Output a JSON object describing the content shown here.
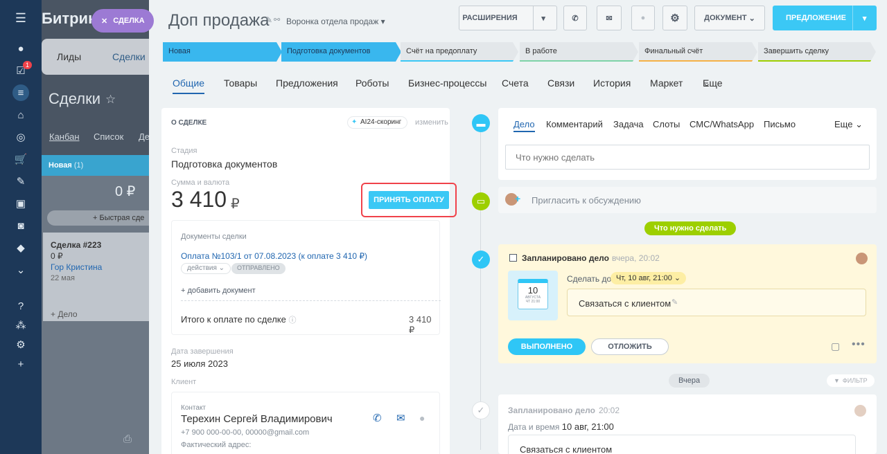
{
  "bg": {
    "app_title": "Битрик",
    "deal_pill": "СДЕЛКА",
    "tab_leads": "Лиды",
    "tab_deals": "Сделки",
    "page": "Сделки",
    "views": [
      "Канбан",
      "Список",
      "Де"
    ],
    "column": "Новая",
    "column_count": "(1)",
    "column_sum": "0 ₽",
    "quick": "+ Быстрая сде",
    "card": {
      "title": "Сделка #223",
      "sum": "0 ₽",
      "client": "Гор Кристина",
      "date": "22 мая",
      "add": "+ Дело"
    }
  },
  "header": {
    "title": "Доп продажа",
    "funnel": "Воронка отдела продаж",
    "btn_ext": "РАСШИРЕНИЯ",
    "btn_doc": "ДОКУМЕНТ",
    "btn_offer": "ПРЕДЛОЖЕНИЕ"
  },
  "stages": [
    {
      "label": "Новая"
    },
    {
      "label": "Подготовка документов"
    },
    {
      "label": "Счёт на предоплату"
    },
    {
      "label": "В работе"
    },
    {
      "label": "Финальный счёт"
    },
    {
      "label": "Завершить сделку"
    }
  ],
  "tabs": [
    "Общие",
    "Товары",
    "Предложения",
    "Роботы",
    "Бизнес-процессы",
    "Счета",
    "Связи",
    "История",
    "Маркет",
    "Еще"
  ],
  "deal": {
    "section": "О СДЕЛКЕ",
    "scoring": "AI24-скоринг",
    "edit": "изменить",
    "stage_label": "Стадия",
    "stage_value": "Подготовка документов",
    "sum_label": "Сумма и валюта",
    "sum_value": "3 410",
    "currency": "₽",
    "accept_btn": "ПРИНЯТЬ ОПЛАТУ",
    "docs_label": "Документы сделки",
    "doc_link": "Оплата №103/1 от 07.08.2023 (к оплате 3 410 ₽)",
    "doc_actions": "действия",
    "doc_status": "ОТПРАВЛЕНО",
    "add_doc": "+ добавить документ",
    "total_label": "Итого к оплате по сделке",
    "total_value": "3 410 ₽",
    "close_label": "Дата завершения",
    "close_value": "25 июля 2023",
    "client_label": "Клиент",
    "contact_label": "Контакт",
    "contact_name": "Терехин Сергей Владимирович",
    "contact_phone": "+7 900 000-00-00, 00000@gmail.com",
    "contact_addr": "Фактический адрес:"
  },
  "activity": {
    "tabs": [
      "Дело",
      "Комментарий",
      "Задача",
      "Слоты",
      "СМС/WhatsApp",
      "Письмо",
      "Еще"
    ],
    "placeholder": "Что нужно сделать",
    "invite": "Пригласить к обсуждению",
    "todo_pill": "Что нужно сделать"
  },
  "task": {
    "title": "Запланировано дело",
    "time": "вчера, 20:02",
    "deadline_label": "Сделать до",
    "deadline": "Чт, 10 авг, 21:00",
    "cal_day": "10",
    "cal_month": "АВГУСТА",
    "cal_sub": "ЧТ 21:00",
    "text": "Связаться с клиентом",
    "done_btn": "ВЫПОЛНЕНО",
    "later_btn": "ОТЛОЖИТЬ"
  },
  "yesterday": {
    "pill": "Вчера",
    "filter": "ФИЛЬТР"
  },
  "done": {
    "title": "Запланировано дело",
    "time": "20:02",
    "dt_label": "Дата и время",
    "dt_value": "10 авг, 21:00",
    "text": "Связаться с клиентом"
  },
  "colors": {
    "accent": "#3bc8f5",
    "nav": "#1d3858",
    "green": "#9dcf00",
    "highlight": "#f0424a"
  }
}
